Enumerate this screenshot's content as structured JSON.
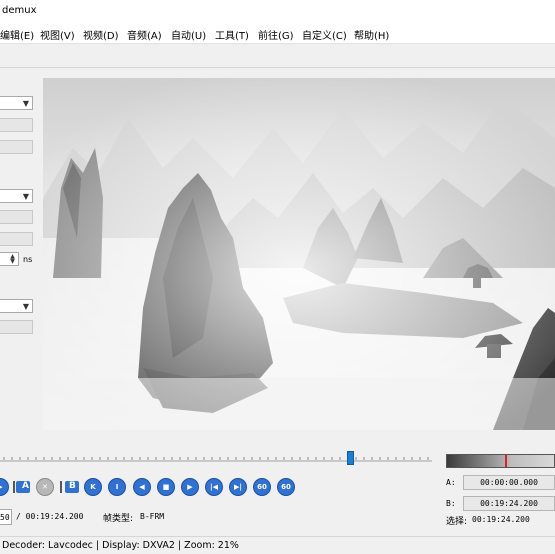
{
  "window": {
    "title": "demux"
  },
  "menu": [
    "编辑(E)",
    "视图(V)",
    "视频(D)",
    "音频(A)",
    "自动(U)",
    "工具(T)",
    "前往(G)",
    "自定义(C)",
    "帮助(H)"
  ],
  "left_panel": {
    "spin_unit": "ns"
  },
  "markers": {
    "a_label": "A",
    "b_label": "B"
  },
  "nav_buttons": [
    "K",
    "I",
    "◀",
    "■",
    "▶",
    "|◀",
    "▶|",
    "60",
    "60"
  ],
  "time": {
    "current_partial": "50",
    "total": "/ 00:19:24.200",
    "frame_type_label": "帧类型:",
    "frame_type": "B-FRM"
  },
  "selection": {
    "a_label": "A:",
    "a_value": "00:00:00.000",
    "b_label": "B:",
    "b_value": "00:19:24.200",
    "sel_label": "选择:",
    "sel_value": "00:19:24.200"
  },
  "status": {
    "text": "Decoder: Lavcodec  |  Display: DXVA2  |  Zoom: 21%"
  },
  "colors": {
    "accent": "#2f72d4",
    "slider": "#1c7fd6",
    "selection_marker": "#e02020"
  }
}
